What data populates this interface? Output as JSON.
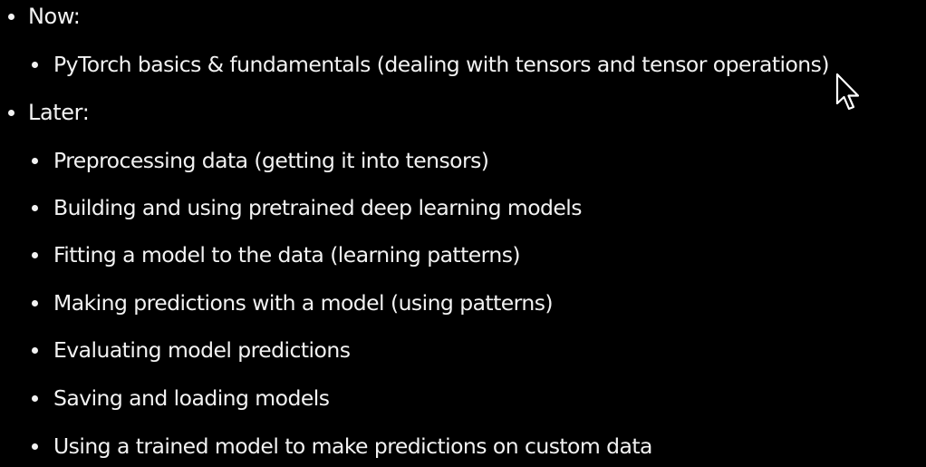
{
  "outline": {
    "now": {
      "heading": "Now:",
      "items": [
        "PyTorch basics & fundamentals (dealing with tensors and tensor operations)"
      ]
    },
    "later": {
      "heading": "Later:",
      "items": [
        "Preprocessing data (getting it into tensors)",
        "Building and using pretrained deep learning models",
        "Fitting a model to the data (learning patterns)",
        "Making predictions with a model (using patterns)",
        "Evaluating model predictions",
        "Saving and loading models",
        "Using a trained model to make predictions on custom data"
      ]
    }
  },
  "cursor": {
    "icon": "mouse-pointer-icon"
  },
  "colors": {
    "background": "#000000",
    "text": "#f2f2f2"
  }
}
